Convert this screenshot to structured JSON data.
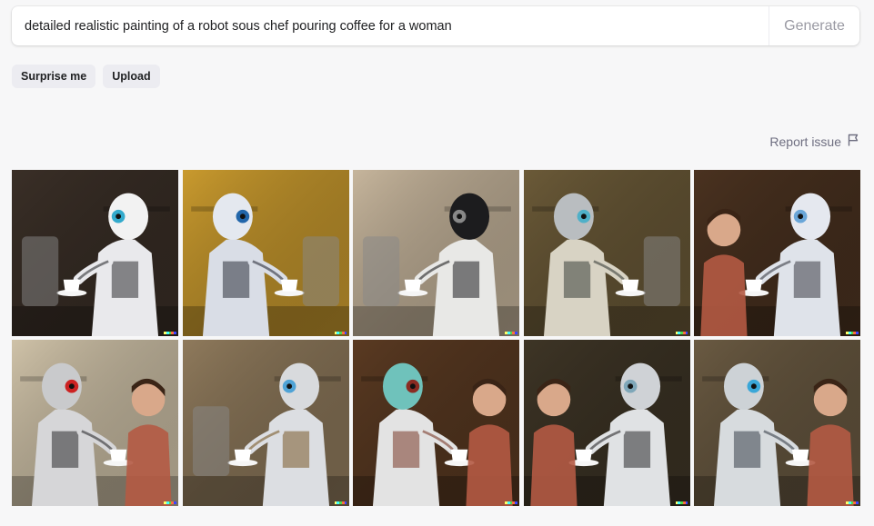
{
  "prompt": {
    "value": "detailed realistic painting of a robot sous chef pouring coffee for a woman",
    "generate_label": "Generate"
  },
  "actions": {
    "surprise_label": "Surprise me",
    "upload_label": "Upload"
  },
  "report": {
    "label": "Report issue",
    "icon": "flag-icon"
  },
  "colors": {
    "page_bg": "#f7f7f8",
    "pill_bg": "#ececf1",
    "muted_text": "#6e6e80",
    "signature": [
      "#ffff66",
      "#42ffff",
      "#51da4c",
      "#ff6e3c",
      "#3c46ff"
    ]
  },
  "images": [
    {
      "bg": "#3a2f27",
      "robot": "#e9e9ec",
      "accent": "#2f3033",
      "head": "#f2f2f2",
      "highlight": "#33aacc",
      "person": false
    },
    {
      "bg": "#c99a2e",
      "robot": "#d9dde6",
      "accent": "#2c2f3a",
      "head": "#e4e8ef",
      "highlight": "#2266aa",
      "person": false
    },
    {
      "bg": "#c6b59c",
      "robot": "#e8e8e6",
      "accent": "#1e1e20",
      "head": "#1c1c1e",
      "highlight": "#888888",
      "person": false
    },
    {
      "bg": "#6b5a38",
      "robot": "#d8d3c4",
      "accent": "#3a3f3a",
      "head": "#b9bdc0",
      "highlight": "#4fb0c8",
      "person": false
    },
    {
      "bg": "#4a3220",
      "robot": "#dfe3ea",
      "accent": "#3a3c44",
      "head": "#e5e8ef",
      "highlight": "#6aa6d8",
      "person": true
    },
    {
      "bg": "#cfc2a8",
      "robot": "#d6d6d8",
      "accent": "#2b2b2e",
      "head": "#c9cacc",
      "highlight": "#cc2222",
      "person": true
    },
    {
      "bg": "#8f7a5c",
      "robot": "#dcdee2",
      "accent": "#7a5a2a",
      "head": "#d8dadd",
      "highlight": "#4fa3d6",
      "person": false
    },
    {
      "bg": "#5a3a22",
      "robot": "#e3e3e3",
      "accent": "#7a3a2a",
      "head": "#6fc2bb",
      "highlight": "#8a2b22",
      "person": true
    },
    {
      "bg": "#3e3526",
      "robot": "#e0e2e4",
      "accent": "#2a2a2c",
      "head": "#cfd2d6",
      "highlight": "#7fa7b9",
      "person": true
    },
    {
      "bg": "#6a5a42",
      "robot": "#d7dbde",
      "accent": "#38404a",
      "head": "#cdd2d6",
      "highlight": "#3aa7d8",
      "person": true
    }
  ]
}
